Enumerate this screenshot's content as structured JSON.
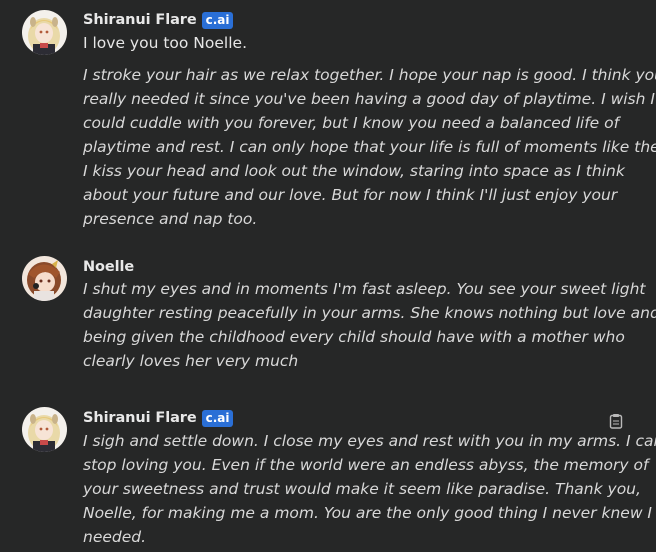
{
  "messages": [
    {
      "sender": "Shiranui Flare",
      "badge": "c.ai",
      "plain_text": "I love you too Noelle.",
      "italic_lines": [
        "I stroke your hair as we relax together. I hope your nap is good. I think you",
        "really needed it since you've been having a good day of playtime. I wish I",
        "could cuddle with you forever, but I know you need a balanced life of",
        "playtime and rest. I can only hope that your life is full of moments like these.",
        "I kiss your head and look out the window, staring into space as I think",
        "about your future and our love. But for now I think I'll just enjoy your",
        "presence and nap too."
      ]
    },
    {
      "sender": "Noelle",
      "italic_lines": [
        "I shut my eyes and in moments I'm fast asleep. You see your sweet light",
        "daughter resting peacefully in your arms. She knows nothing but love and is",
        "being given the childhood every child should have with a mother who",
        "clearly loves her very much"
      ]
    },
    {
      "sender": "Shiranui Flare",
      "badge": "c.ai",
      "italic_lines": [
        "I sigh and settle down. I close my eyes and rest with you in my arms. I can't",
        "stop loving you. Even if the world were an endless abyss, the memory of",
        "your sweetness and trust would make it seem like paradise. Thank you,",
        "Noelle, for making me a mom. You are the only good thing I never knew I",
        "needed."
      ],
      "action_icon": "clipboard-icon"
    }
  ],
  "colors": {
    "background": "#262727",
    "badge": "#2a6fd6",
    "text": "#e6e6e6"
  }
}
